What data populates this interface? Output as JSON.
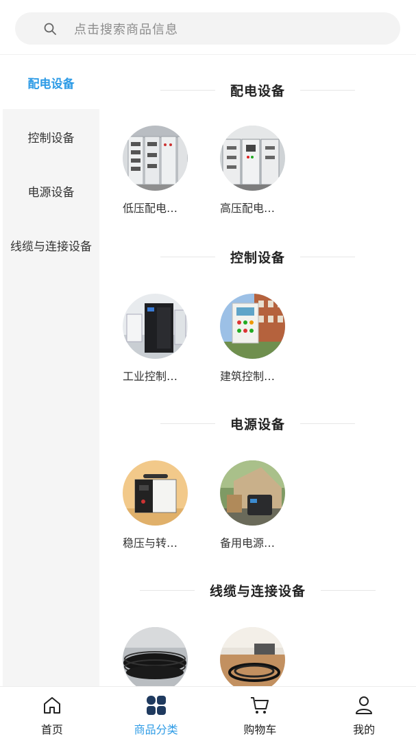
{
  "search": {
    "placeholder": "点击搜索商品信息"
  },
  "sidebar": {
    "items": [
      {
        "label": "配电设备",
        "active": true
      },
      {
        "label": "控制设备",
        "active": false
      },
      {
        "label": "电源设备",
        "active": false
      },
      {
        "label": "线缆与连接设备",
        "active": false
      }
    ]
  },
  "sections": [
    {
      "title": "配电设备",
      "products": [
        {
          "label": "低压配电…",
          "icon": "switchgear-cabinet-image"
        },
        {
          "label": "高压配电…",
          "icon": "switchgear-room-image"
        }
      ]
    },
    {
      "title": "控制设备",
      "products": [
        {
          "label": "工业控制…",
          "icon": "industrial-control-cabinet-image"
        },
        {
          "label": "建筑控制…",
          "icon": "building-control-panel-image"
        }
      ]
    },
    {
      "title": "电源设备",
      "products": [
        {
          "label": "稳压与转…",
          "icon": "voltage-stabilizer-image"
        },
        {
          "label": "备用电源…",
          "icon": "portable-power-station-image"
        }
      ]
    },
    {
      "title": "线缆与连接设备",
      "products": [
        {
          "label": "",
          "icon": "cable-coil-image"
        },
        {
          "label": "",
          "icon": "cable-desk-image"
        }
      ]
    }
  ],
  "tabbar": {
    "items": [
      {
        "label": "首页",
        "icon": "home-icon",
        "active": false
      },
      {
        "label": "商品分类",
        "icon": "category-grid-icon",
        "active": true
      },
      {
        "label": "购物车",
        "icon": "cart-icon",
        "active": false
      },
      {
        "label": "我的",
        "icon": "user-icon",
        "active": false
      }
    ]
  },
  "colors": {
    "accent": "#2d9be6",
    "sidebar_bg": "#f5f5f5",
    "search_bg": "#f3f3f3",
    "tab_active_icon": "#1f3a5f"
  }
}
